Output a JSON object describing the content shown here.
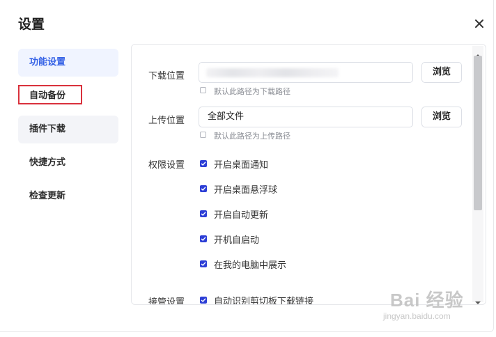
{
  "dialog": {
    "title": "设置",
    "close_icon": "close-icon"
  },
  "nav": {
    "items": [
      {
        "label": "功能设置",
        "state": "active"
      },
      {
        "label": "自动备份",
        "state": "highlighted"
      },
      {
        "label": "插件下载",
        "state": "normal"
      },
      {
        "label": "快捷方式",
        "state": "normal"
      },
      {
        "label": "检查更新",
        "state": "normal"
      }
    ]
  },
  "download": {
    "label": "下载位置",
    "path_value": "",
    "browse_label": "浏览",
    "default_label": "默认此路径为下载路径",
    "default_checked": false
  },
  "upload": {
    "label": "上传位置",
    "path_value": "全部文件",
    "browse_label": "浏览",
    "default_label": "默认此路径为上传路径",
    "default_checked": false
  },
  "permissions": {
    "label": "权限设置",
    "options": [
      {
        "label": "开启桌面通知",
        "checked": true
      },
      {
        "label": "开启桌面悬浮球",
        "checked": true
      },
      {
        "label": "开启自动更新",
        "checked": true
      },
      {
        "label": "开机自启动",
        "checked": true
      },
      {
        "label": "在我的电脑中展示",
        "checked": true
      }
    ]
  },
  "takeover": {
    "label": "接管设置",
    "options": [
      {
        "label": "自动识别剪切板下载链接",
        "checked": true
      }
    ]
  },
  "colors": {
    "accent": "#3461e6",
    "checkbox": "#2d3fd6",
    "highlight_box": "#d9313c",
    "active_nav_bg": "#f0f4ff"
  },
  "watermark": {
    "main": "Bai 经验",
    "sub": "jingyan.baidu.com"
  }
}
